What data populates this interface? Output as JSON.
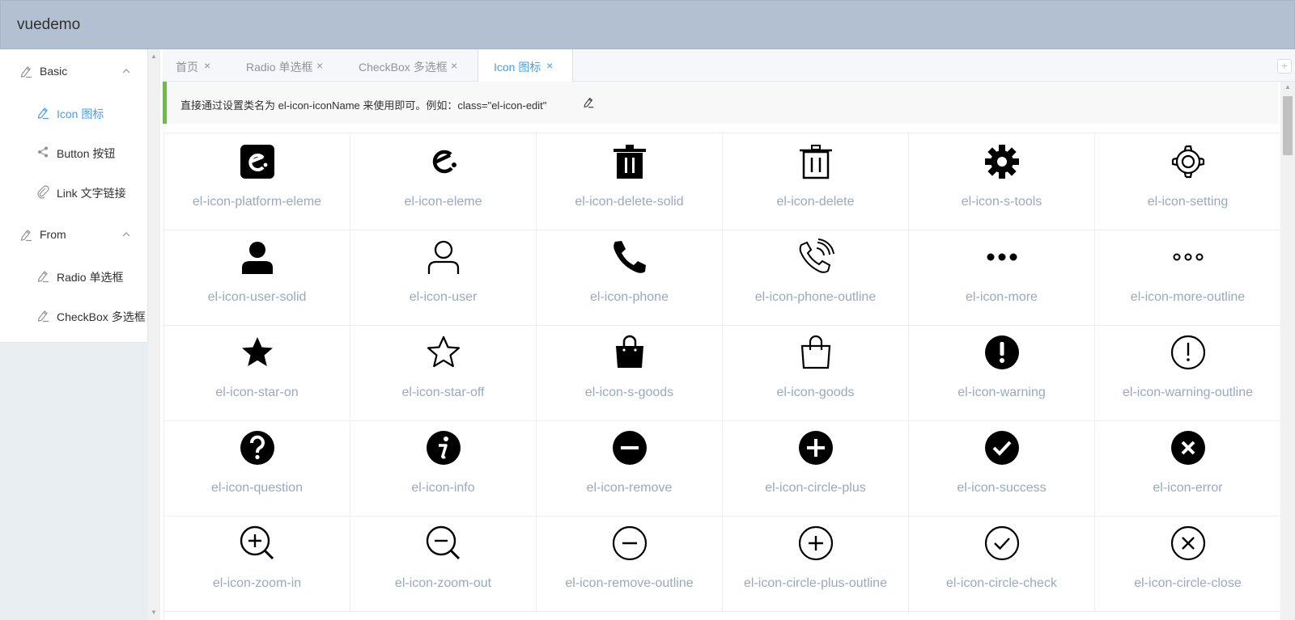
{
  "app": {
    "title": "vuedemo"
  },
  "sidebar": {
    "groups": [
      {
        "label": "Basic",
        "icon": "edit-icon",
        "expanded": true
      },
      {
        "label": "From",
        "icon": "edit-icon",
        "expanded": true
      }
    ],
    "items": [
      {
        "label": "Icon 图标",
        "icon": "edit-icon",
        "active": true
      },
      {
        "label": "Button 按钮",
        "icon": "share-icon",
        "active": false
      },
      {
        "label": "Link 文字链接",
        "icon": "paperclip-icon",
        "active": false
      },
      {
        "label": "Radio 单选框",
        "icon": "edit-icon",
        "active": false
      },
      {
        "label": "CheckBox 多选框",
        "icon": "edit-icon",
        "active": false
      }
    ]
  },
  "tabs": [
    {
      "label": "首页",
      "active": false
    },
    {
      "label": "Radio 单选框",
      "active": false
    },
    {
      "label": "CheckBox 多选框",
      "active": false
    },
    {
      "label": "Icon 图标",
      "active": true
    }
  ],
  "tab_add_label": "+",
  "notice": {
    "text": "直接通过设置类名为 el-icon-iconName 来使用即可。例如：class=\"el-icon-edit\""
  },
  "icons": [
    "el-icon-platform-eleme",
    "el-icon-eleme",
    "el-icon-delete-solid",
    "el-icon-delete",
    "el-icon-s-tools",
    "el-icon-setting",
    "el-icon-user-solid",
    "el-icon-user",
    "el-icon-phone",
    "el-icon-phone-outline",
    "el-icon-more",
    "el-icon-more-outline",
    "el-icon-star-on",
    "el-icon-star-off",
    "el-icon-s-goods",
    "el-icon-goods",
    "el-icon-warning",
    "el-icon-warning-outline",
    "el-icon-question",
    "el-icon-info",
    "el-icon-remove",
    "el-icon-circle-plus",
    "el-icon-success",
    "el-icon-error",
    "el-icon-zoom-in",
    "el-icon-zoom-out",
    "el-icon-remove-outline",
    "el-icon-circle-plus-outline",
    "el-icon-circle-check",
    "el-icon-circle-close"
  ],
  "colors": {
    "header": "#b3c0d1",
    "accent": "#409eff",
    "icon_label": "#99a9bf",
    "notice_border": "#67c23a"
  }
}
